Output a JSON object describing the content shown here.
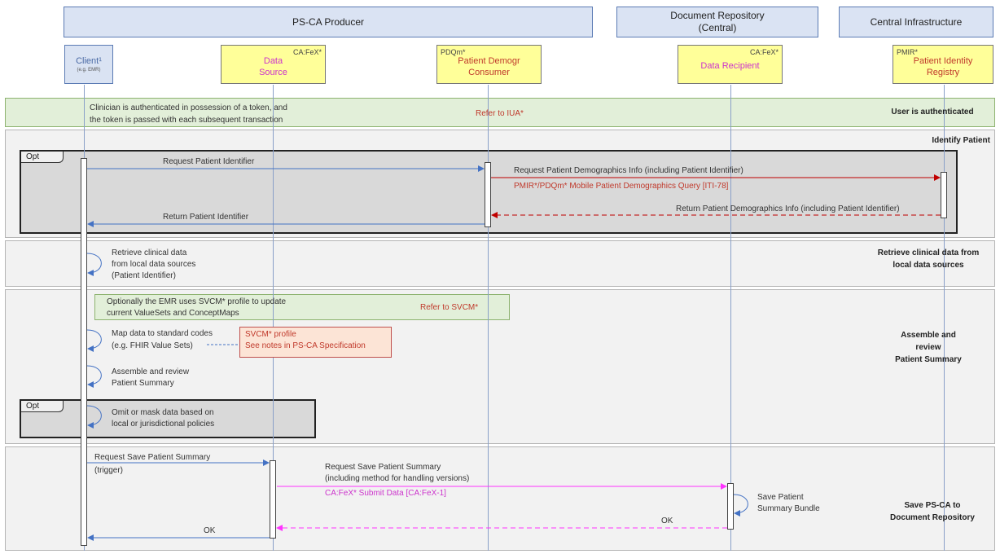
{
  "groups": {
    "producer": "PS-CA Producer",
    "repository_line1": "Document Repository",
    "repository_line2": "(Central)",
    "central": "Central Infrastructure"
  },
  "actors": {
    "client": {
      "name": "Client¹",
      "sub": "(e.g. EMR)"
    },
    "data_source": {
      "tag": "CA:FeX*",
      "line1": "Data",
      "line2": "Source"
    },
    "pdqm": {
      "tag": "PDQm*",
      "line1": "Patient Demogr",
      "line2": "Consumer"
    },
    "recipient": {
      "tag": "CA:FeX*",
      "line1": "Data Recipient"
    },
    "pmir": {
      "tag": "PMIR*",
      "line1": "Patient Identity",
      "line2": "Registry"
    }
  },
  "auth": {
    "text1": "Clinician is authenticated in possession of a token, and",
    "text2": "the token is passed with each subsequent transaction",
    "ref": "Refer to IUA*",
    "label": "User is authenticated"
  },
  "identify": {
    "label": "Identify Patient",
    "opt": "Opt",
    "req": "Request Patient Identifier",
    "req_demo": "Request Patient Demographics Info (including Patient Identifier)",
    "query": "PMIR*/PDQm*  Mobile Patient Demographics Query [ITI-78]",
    "ret_demo": "Return Patient Demographics Info (including Patient Identifier)",
    "ret": "Return Patient Identifier"
  },
  "retrieve": {
    "line1": "Retrieve clinical data",
    "line2": "from local data sources",
    "line3": "(Patient Identifier)",
    "label1": "Retrieve clinical data from",
    "label2": "local data sources"
  },
  "assemble": {
    "svcm_line1": "Optionally the EMR uses SVCM*  profile to update",
    "svcm_line2": "current ValueSets and ConceptMaps",
    "svcm_ref": "Refer to SVCM*",
    "map1": "Map data to standard codes",
    "map2": "(e.g. FHIR Value Sets)",
    "note1": "SVCM* profile",
    "note2": "See notes in PS-CA Specification",
    "asm1": "Assemble  and review",
    "asm2": "Patient Summary",
    "opt": "Opt",
    "omit1": "Omit or mask data based on",
    "omit2": "local or jurisdictional policies",
    "label1": "Assemble and",
    "label2": "review",
    "label3": "Patient Summary"
  },
  "save": {
    "req1": "Request Save Patient Summary",
    "req2": "(trigger)",
    "req_save1": "Request Save Patient Summary",
    "req_save2": "(including method for handling versions)",
    "submit": "CA:FeX* Submit Data [CA:FeX-1]",
    "bundle1": "Save Patient",
    "bundle2": "Summary Bundle",
    "ok1": "OK",
    "ok2": "OK",
    "label1": "Save PS-CA to",
    "label2": "Document Repository"
  },
  "colors": {
    "blue_arrow": "#4472c4",
    "red_arrow": "#c00000",
    "magenta_arrow": "#ff33ff"
  }
}
